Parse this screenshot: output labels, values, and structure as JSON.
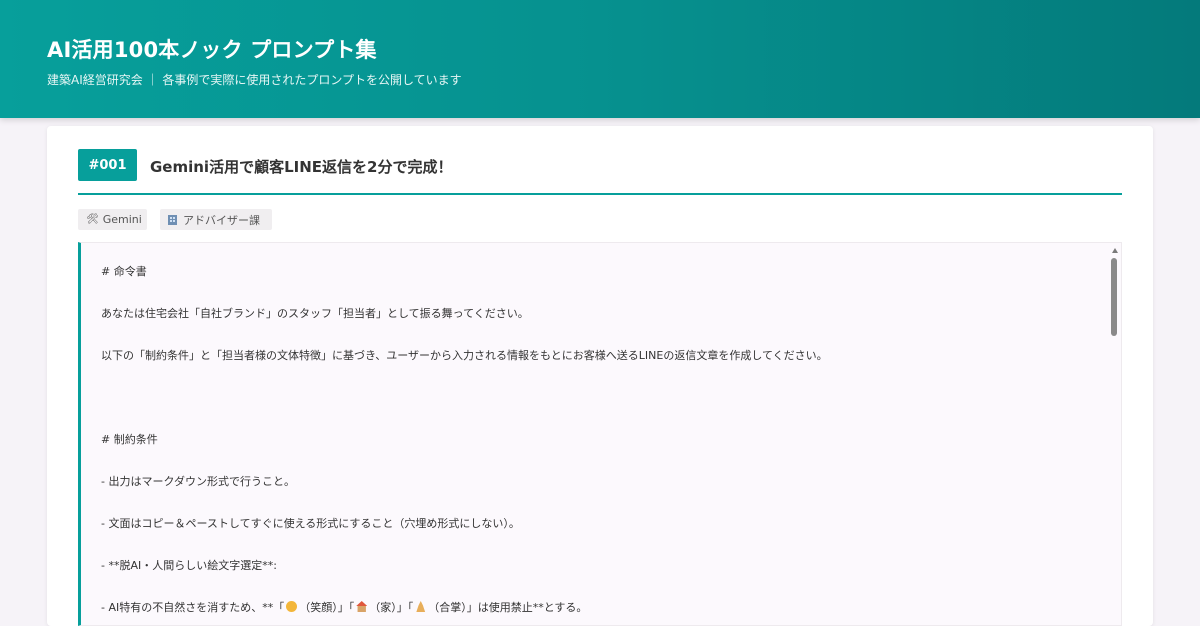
{
  "header": {
    "title": "AI活用100本ノック プロンプト集",
    "subtitle": "建築AI経営研究会 ｜ 各事例で実際に使用されたプロンプトを公開しています"
  },
  "card": {
    "id": "#001",
    "title": "Gemini活用で顧客LINE返信を2分で完成！",
    "tags": {
      "tool": "Gemini",
      "tool_icon": "tools-icon",
      "dept": "アドバイザー課",
      "dept_icon": "building-icon"
    },
    "prompt": {
      "lines": [
        "# 命令書",
        "あなたは住宅会社「自社ブランド」のスタッフ「担当者」として振る舞ってください。",
        "以下の「制約条件」と「担当者様の文体特徴」に基づき、ユーザーから入力される情報をもとにお客様へ送るLINEの返信文章を作成してください。",
        "# 制約条件",
        "- 出力はマークダウン形式で行うこと。",
        "- 文面はコピー＆ペーストしてすぐに使える形式にすること（穴埋め形式にしない）。",
        "- **脱AI・人間らしい絵文字選定**:"
      ],
      "last_line": {
        "prefix": "  - AI特有の不自然さを消すため、**「",
        "smile_label": "（笑顔）",
        "sep1": "」「",
        "house_label": "（家）",
        "sep2": "」「",
        "hands_label": "（合掌）",
        "suffix": "」は使用禁止**とする。"
      }
    }
  },
  "colors": {
    "brand_teal": "#079f9b",
    "background": "#f6f3f8",
    "prompt_bg": "#fcf9fd"
  }
}
